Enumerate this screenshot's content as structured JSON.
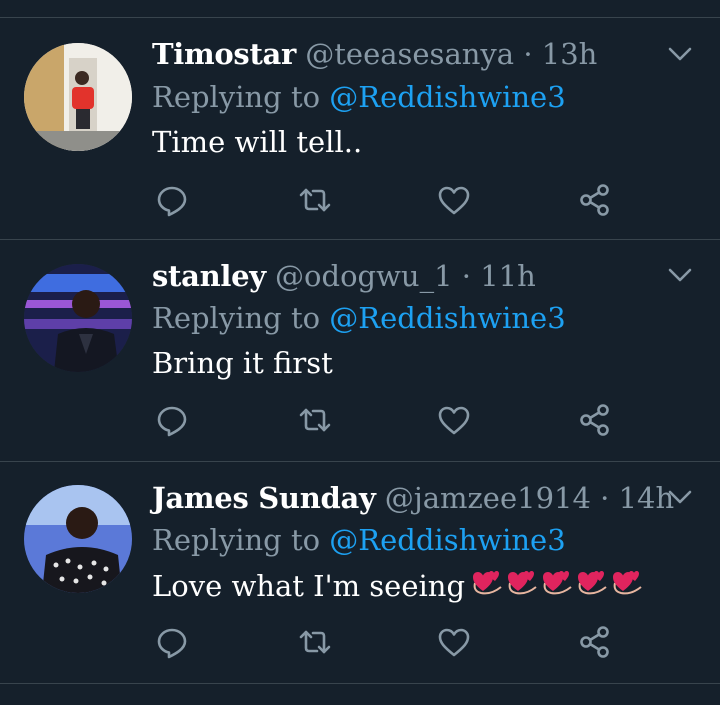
{
  "tweets": [
    {
      "name": "Timostar",
      "handle": "@teeasesanya",
      "separator": "·",
      "time": "13h",
      "replying_prefix": "Replying to",
      "replying_to": "@Reddishwine3",
      "text": "Time will tell..",
      "emoji_count": 0
    },
    {
      "name": "stanley",
      "handle": "@odogwu_1",
      "separator": "·",
      "time": "11h",
      "replying_prefix": "Replying to",
      "replying_to": "@Reddishwine3",
      "text": "Bring it first",
      "emoji_count": 0
    },
    {
      "name": "James Sunday",
      "handle": "@jamzee1914",
      "separator": "·",
      "time": "14h",
      "replying_prefix": "Replying to",
      "replying_to": "@Reddishwine3",
      "text": "Love what I'm seeing",
      "emoji_count": 5,
      "emoji": "revolving-hearts"
    }
  ],
  "icons": {
    "reply": "reply-icon",
    "retweet": "retweet-icon",
    "like": "heart-icon",
    "share": "share-icon",
    "more": "chevron-down-icon"
  },
  "colors": {
    "background": "#15202b",
    "divider": "#38444d",
    "secondary_text": "#8899a6",
    "link": "#1da1f2",
    "primary_text": "#ffffff"
  }
}
